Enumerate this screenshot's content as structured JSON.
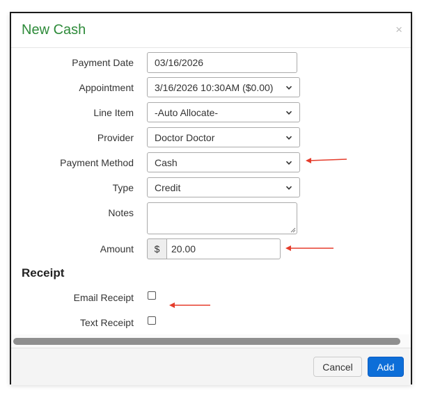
{
  "dialog": {
    "title": "New Cash",
    "close_glyph": "×"
  },
  "form": {
    "payment_date": {
      "label": "Payment Date",
      "value": "03/16/2026"
    },
    "appointment": {
      "label": "Appointment",
      "value": "3/16/2026 10:30AM ($0.00)"
    },
    "line_item": {
      "label": "Line Item",
      "value": "-Auto Allocate-"
    },
    "provider": {
      "label": "Provider",
      "value": "Doctor Doctor"
    },
    "payment_method": {
      "label": "Payment Method",
      "value": "Cash"
    },
    "type": {
      "label": "Type",
      "value": "Credit"
    },
    "notes": {
      "label": "Notes",
      "value": ""
    },
    "amount": {
      "label": "Amount",
      "prefix": "$",
      "value": "20.00"
    }
  },
  "receipt": {
    "heading": "Receipt",
    "email_label": "Email Receipt",
    "text_label": "Text Receipt",
    "email_checked": false,
    "text_checked": false
  },
  "footer": {
    "cancel_label": "Cancel",
    "add_label": "Add"
  },
  "colors": {
    "title": "#2e8b3a",
    "primary_button": "#0d6ed8",
    "annotation_arrow": "#e53c2b"
  },
  "icons": {
    "close": "close-icon",
    "select_chevron": "chevron-down-icon",
    "annotation": "arrow-left-icon"
  }
}
